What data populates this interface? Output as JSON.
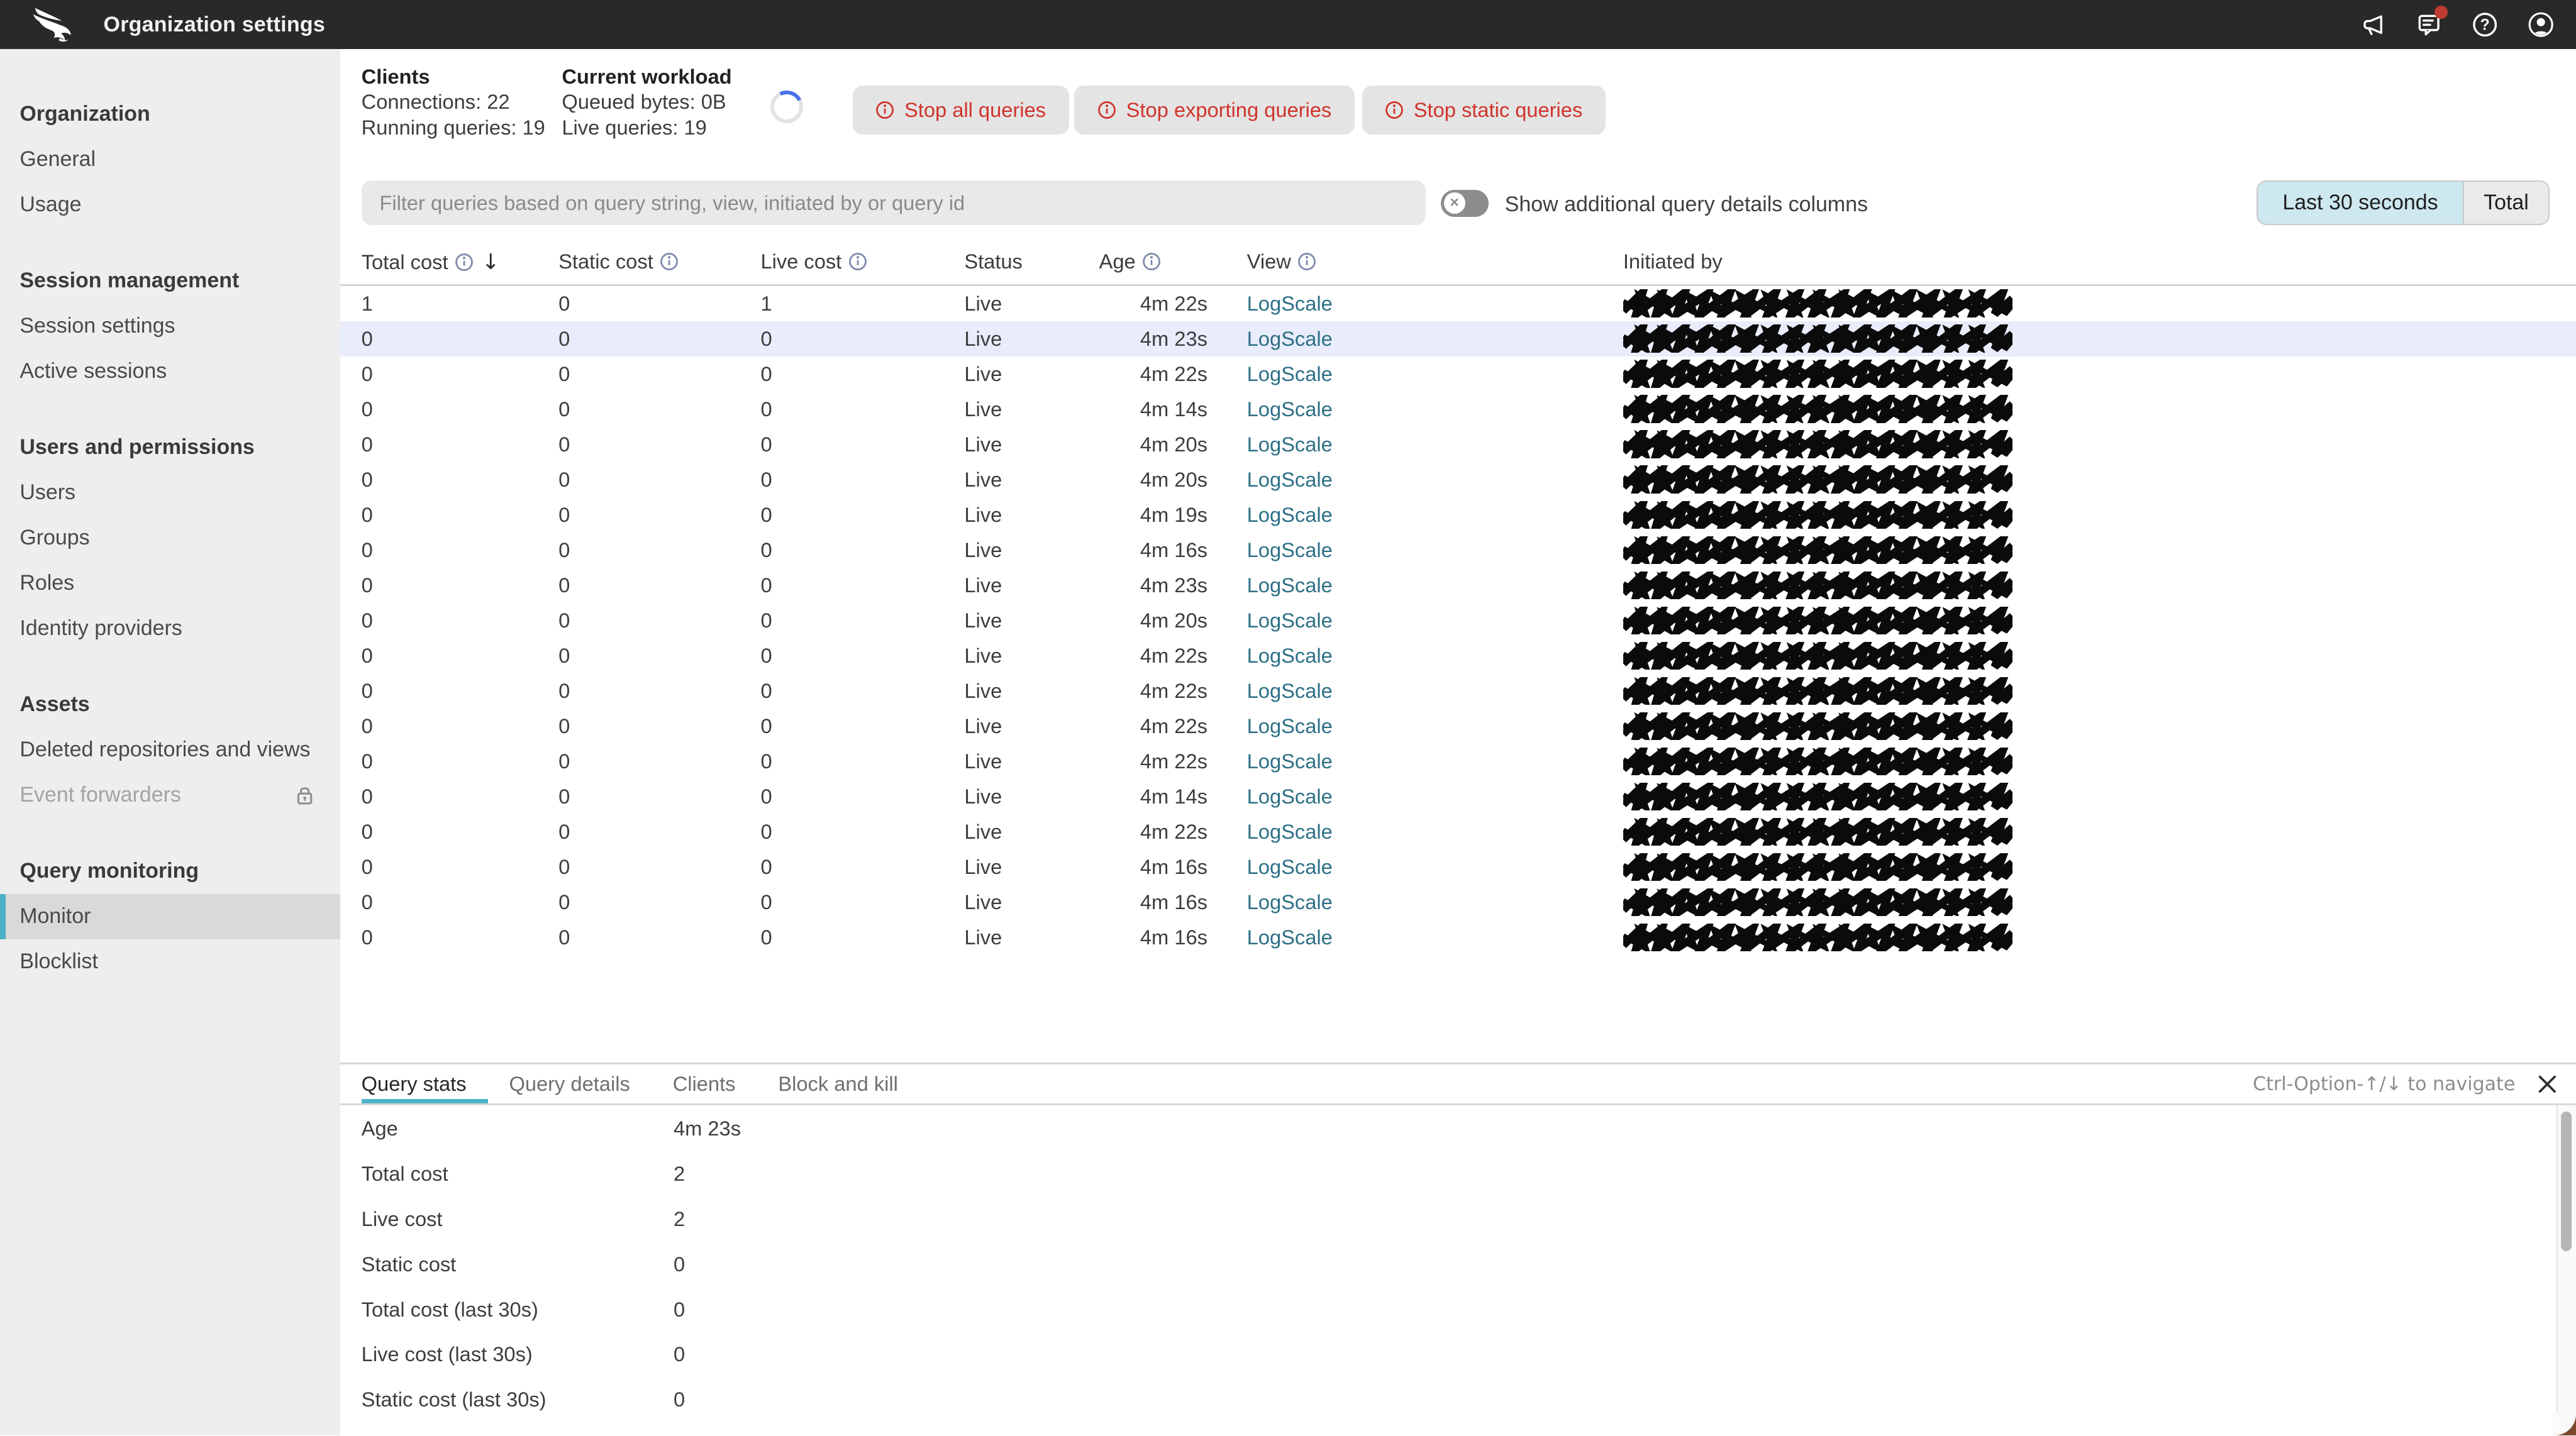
{
  "topbar": {
    "title": "Organization settings",
    "icons": [
      "announcements-icon",
      "feedback-icon",
      "help-icon",
      "profile-icon"
    ]
  },
  "sidebar": {
    "sections": [
      {
        "title": "Organization",
        "items": [
          {
            "label": "General"
          },
          {
            "label": "Usage"
          }
        ]
      },
      {
        "title": "Session management",
        "items": [
          {
            "label": "Session settings"
          },
          {
            "label": "Active sessions"
          }
        ]
      },
      {
        "title": "Users and permissions",
        "items": [
          {
            "label": "Users"
          },
          {
            "label": "Groups"
          },
          {
            "label": "Roles"
          },
          {
            "label": "Identity providers"
          }
        ]
      },
      {
        "title": "Assets",
        "items": [
          {
            "label": "Deleted repositories and views"
          },
          {
            "label": "Event forwarders",
            "disabled": true,
            "lock": true
          }
        ]
      },
      {
        "title": "Query monitoring",
        "items": [
          {
            "label": "Monitor",
            "selected": true
          },
          {
            "label": "Blocklist"
          }
        ]
      }
    ]
  },
  "summary": {
    "clients": {
      "title": "Clients",
      "line1": "Connections: 22",
      "line2": "Running queries: 19"
    },
    "workload": {
      "title": "Current workload",
      "line1": "Queued bytes: 0B",
      "line2": "Live queries: 19"
    }
  },
  "actions": {
    "stop_all": "Stop all queries",
    "stop_exporting": "Stop exporting queries",
    "stop_static": "Stop static queries"
  },
  "filter": {
    "placeholder": "Filter queries based on query string, view, initiated by or query id"
  },
  "toggle": {
    "label": "Show additional query details columns",
    "state": "off"
  },
  "range": {
    "selected": "Last 30 seconds",
    "other": "Total"
  },
  "table": {
    "headers": {
      "total": "Total cost",
      "static": "Static cost",
      "live": "Live cost",
      "status": "Status",
      "age": "Age",
      "view": "View",
      "initiated": "Initiated by"
    },
    "rows": [
      {
        "total": "1",
        "static": "0",
        "live": "1",
        "status": "Live",
        "age": "4m 22s",
        "view": "LogScale"
      },
      {
        "total": "0",
        "static": "0",
        "live": "0",
        "status": "Live",
        "age": "4m 23s",
        "view": "LogScale",
        "highlight": true
      },
      {
        "total": "0",
        "static": "0",
        "live": "0",
        "status": "Live",
        "age": "4m 22s",
        "view": "LogScale"
      },
      {
        "total": "0",
        "static": "0",
        "live": "0",
        "status": "Live",
        "age": "4m 14s",
        "view": "LogScale"
      },
      {
        "total": "0",
        "static": "0",
        "live": "0",
        "status": "Live",
        "age": "4m 20s",
        "view": "LogScale"
      },
      {
        "total": "0",
        "static": "0",
        "live": "0",
        "status": "Live",
        "age": "4m 20s",
        "view": "LogScale"
      },
      {
        "total": "0",
        "static": "0",
        "live": "0",
        "status": "Live",
        "age": "4m 19s",
        "view": "LogScale"
      },
      {
        "total": "0",
        "static": "0",
        "live": "0",
        "status": "Live",
        "age": "4m 16s",
        "view": "LogScale"
      },
      {
        "total": "0",
        "static": "0",
        "live": "0",
        "status": "Live",
        "age": "4m 23s",
        "view": "LogScale"
      },
      {
        "total": "0",
        "static": "0",
        "live": "0",
        "status": "Live",
        "age": "4m 20s",
        "view": "LogScale"
      },
      {
        "total": "0",
        "static": "0",
        "live": "0",
        "status": "Live",
        "age": "4m 22s",
        "view": "LogScale"
      },
      {
        "total": "0",
        "static": "0",
        "live": "0",
        "status": "Live",
        "age": "4m 22s",
        "view": "LogScale"
      },
      {
        "total": "0",
        "static": "0",
        "live": "0",
        "status": "Live",
        "age": "4m 22s",
        "view": "LogScale"
      },
      {
        "total": "0",
        "static": "0",
        "live": "0",
        "status": "Live",
        "age": "4m 22s",
        "view": "LogScale"
      },
      {
        "total": "0",
        "static": "0",
        "live": "0",
        "status": "Live",
        "age": "4m 14s",
        "view": "LogScale"
      },
      {
        "total": "0",
        "static": "0",
        "live": "0",
        "status": "Live",
        "age": "4m 22s",
        "view": "LogScale"
      },
      {
        "total": "0",
        "static": "0",
        "live": "0",
        "status": "Live",
        "age": "4m 16s",
        "view": "LogScale"
      },
      {
        "total": "0",
        "static": "0",
        "live": "0",
        "status": "Live",
        "age": "4m 16s",
        "view": "LogScale"
      },
      {
        "total": "0",
        "static": "0",
        "live": "0",
        "status": "Live",
        "age": "4m 16s",
        "view": "LogScale"
      }
    ]
  },
  "details": {
    "tabs": [
      {
        "label": "Query stats",
        "active": true
      },
      {
        "label": "Query details"
      },
      {
        "label": "Clients"
      },
      {
        "label": "Block and kill"
      }
    ],
    "hint": "Ctrl-Option-↑/↓ to navigate",
    "rows": [
      {
        "label": "Age",
        "value": "4m 23s"
      },
      {
        "label": "Total cost",
        "value": "2"
      },
      {
        "label": "Live cost",
        "value": "2"
      },
      {
        "label": "Static cost",
        "value": "0"
      },
      {
        "label": "Total cost (last 30s)",
        "value": "0"
      },
      {
        "label": "Live cost (last 30s)",
        "value": "0"
      },
      {
        "label": "Static cost (last 30s)",
        "value": "0"
      }
    ]
  },
  "colors": {
    "topbar_bg": "#2b2928",
    "sidebar_bg": "#efeeee",
    "accent_teal": "#4cb1c9",
    "link_teal": "#2d7086",
    "danger_red": "#d0342c",
    "notification_red": "#bf3a30",
    "row_highlight": "#e9ecfa",
    "segment_active": "#cde8ee",
    "spinner_blue": "#4a73e8"
  }
}
